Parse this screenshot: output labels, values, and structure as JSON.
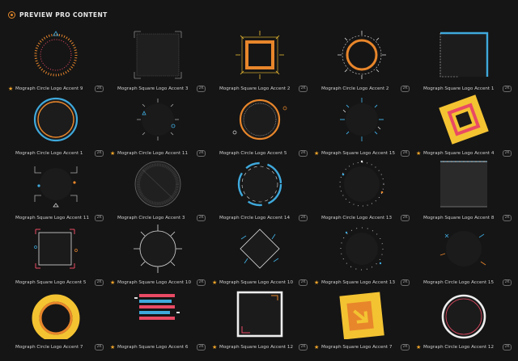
{
  "header": {
    "title": "PREVIEW PRO CONTENT",
    "icon": "play-circle-icon"
  },
  "colors": {
    "accent": "#f0a429",
    "background": "#151515",
    "blue": "#3fa9dc",
    "orange": "#e8862b",
    "pink": "#e94a64",
    "yellow": "#f3c332"
  },
  "cards": [
    {
      "name": "Mograph Circle Logo Accent 9",
      "badge": "2K",
      "starred": true
    },
    {
      "name": "Mograph Square Logo Accent 3",
      "badge": "2K",
      "starred": false
    },
    {
      "name": "Mograph Square Logo Accent 2",
      "badge": "2K",
      "starred": false
    },
    {
      "name": "Mograph Circle Logo Accent 2",
      "badge": "2K",
      "starred": false
    },
    {
      "name": "Mograph Square Logo Accent 1",
      "badge": "2K",
      "starred": false
    },
    {
      "name": "Mograph Circle Logo Accent 1",
      "badge": "2K",
      "starred": false
    },
    {
      "name": "Mograph Circle Logo Accent 11",
      "badge": "2K",
      "starred": true
    },
    {
      "name": "Mograph Circle Logo Accent 5",
      "badge": "2K",
      "starred": false
    },
    {
      "name": "Mograph Square Logo Accent 15",
      "badge": "2K",
      "starred": true
    },
    {
      "name": "Mograph Square Logo Accent 4",
      "badge": "2K",
      "starred": true
    },
    {
      "name": "Mograph Square Logo Accent 11",
      "badge": "2K",
      "starred": false
    },
    {
      "name": "Mograph Circle Logo Accent 3",
      "badge": "2K",
      "starred": false
    },
    {
      "name": "Mograph Circle Logo Accent 14",
      "badge": "2K",
      "starred": false
    },
    {
      "name": "Mograph Circle Logo Accent 13",
      "badge": "2K",
      "starred": false
    },
    {
      "name": "Mograph Square Logo Accent 8",
      "badge": "2K",
      "starred": false
    },
    {
      "name": "Mograph Square Logo Accent 5",
      "badge": "2K",
      "starred": false
    },
    {
      "name": "Mograph Square Logo Accent 10",
      "badge": "2K",
      "starred": true
    },
    {
      "name": "Mograph Square Logo Accent 10",
      "badge": "2K",
      "starred": true
    },
    {
      "name": "Mograph Square Logo Accent 13",
      "badge": "2K",
      "starred": true
    },
    {
      "name": "Mograph Circle Logo Accent 15",
      "badge": "2K",
      "starred": false
    },
    {
      "name": "Mograph Circle Logo Accent 7",
      "badge": "2K",
      "starred": false
    },
    {
      "name": "Mograph Square Logo Accent 6",
      "badge": "2K",
      "starred": true
    },
    {
      "name": "Mograph Square Logo Accent 12",
      "badge": "2K",
      "starred": true
    },
    {
      "name": "Mograph Square Logo Accent 7",
      "badge": "2K",
      "starred": true
    },
    {
      "name": "Mograph Circle Logo Accent 12",
      "badge": "2K",
      "starred": true
    }
  ]
}
